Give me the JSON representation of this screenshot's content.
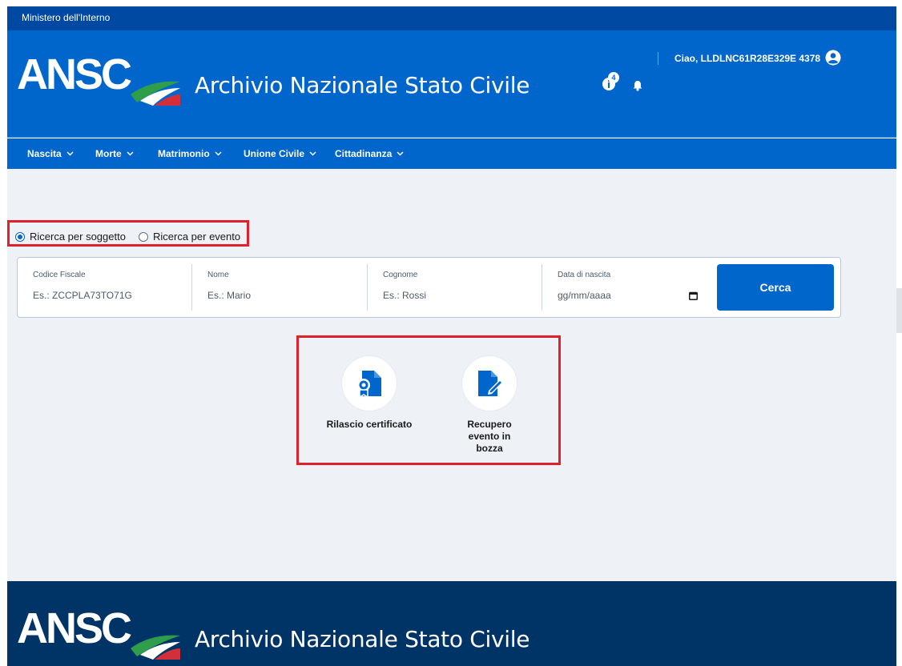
{
  "topbar": {
    "ministry": "Ministero dell'Interno"
  },
  "header": {
    "logo_text": "ANSC",
    "title": "Archivio Nazionale Stato Civile",
    "notification_badge": "4",
    "greeting": "Ciao, LLDLNC61R28E329E 4378"
  },
  "nav": {
    "items": [
      {
        "label": "Nascita"
      },
      {
        "label": "Morte"
      },
      {
        "label": "Matrimonio"
      },
      {
        "label": "Unione Civile"
      },
      {
        "label": "Cittadinanza"
      }
    ]
  },
  "search_mode": {
    "options": [
      {
        "label": "Ricerca per soggetto",
        "checked": true
      },
      {
        "label": "Ricerca per evento",
        "checked": false
      }
    ]
  },
  "search": {
    "fields": [
      {
        "label": "Codice Fiscale",
        "placeholder": "Es.: ZCCPLA73TO71G"
      },
      {
        "label": "Nome",
        "placeholder": "Es.: Mario"
      },
      {
        "label": "Cognome",
        "placeholder": "Es.: Rossi"
      },
      {
        "label": "Data di nascita",
        "placeholder": "gg/mm/aaaa"
      }
    ],
    "button_label": "Cerca"
  },
  "actions": [
    {
      "label": "Rilascio certificato",
      "icon": "certificate-icon"
    },
    {
      "label": "Recupero evento in bozza",
      "icon": "edit-document-icon"
    }
  ],
  "footer": {
    "logo_text": "ANSC",
    "title": "Archivio Nazionale Stato Civile"
  },
  "colors": {
    "primary": "#0066cc",
    "topbar": "#0049a3",
    "footer": "#003366",
    "highlight": "#e0202a",
    "background": "#eef2f7"
  }
}
